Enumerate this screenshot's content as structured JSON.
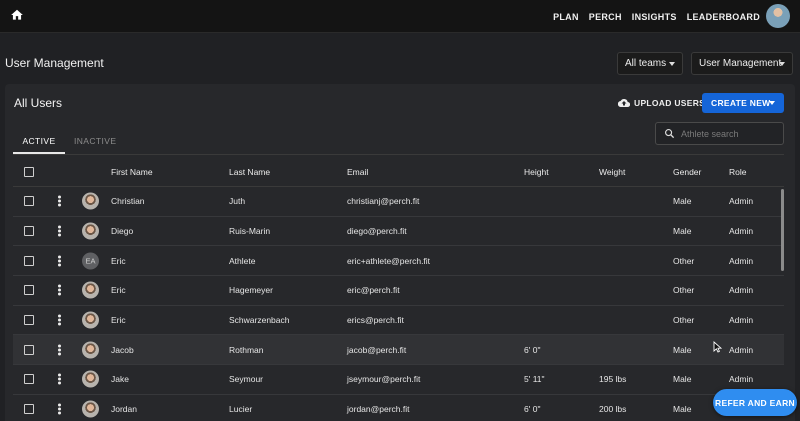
{
  "nav": {
    "home_icon": "home-icon",
    "items": [
      "PLAN",
      "PERCH",
      "INSIGHTS",
      "LEADERBOARD"
    ]
  },
  "header": {
    "title": "User Management",
    "teams_select": "All teams",
    "section_select": "User Management"
  },
  "panel": {
    "title": "All Users",
    "upload_label": "UPLOAD USERS",
    "create_label": "CREATE NEW",
    "tabs": [
      "ACTIVE",
      "INACTIVE"
    ],
    "active_tab": "ACTIVE",
    "search_placeholder": "Athlete search"
  },
  "table": {
    "columns": [
      "First Name",
      "Last Name",
      "Email",
      "Height",
      "Weight",
      "Gender",
      "Role"
    ],
    "rows": [
      {
        "avatar": "photo",
        "first": "Christian",
        "last": "Juth",
        "email": "christianj@perch.fit",
        "height": "",
        "weight": "",
        "gender": "Male",
        "role": "Admin"
      },
      {
        "avatar": "photo",
        "first": "Diego",
        "last": "Ruis-Marin",
        "email": "diego@perch.fit",
        "height": "",
        "weight": "",
        "gender": "Male",
        "role": "Admin"
      },
      {
        "avatar": "initials",
        "initials": "EA",
        "first": "Eric",
        "last": "Athlete",
        "email": "eric+athlete@perch.fit",
        "height": "",
        "weight": "",
        "gender": "Other",
        "role": "Admin"
      },
      {
        "avatar": "photo",
        "first": "Eric",
        "last": "Hagemeyer",
        "email": "eric@perch.fit",
        "height": "",
        "weight": "",
        "gender": "Other",
        "role": "Admin"
      },
      {
        "avatar": "photo",
        "first": "Eric",
        "last": "Schwarzenbach",
        "email": "erics@perch.fit",
        "height": "",
        "weight": "",
        "gender": "Other",
        "role": "Admin"
      },
      {
        "avatar": "photo",
        "first": "Jacob",
        "last": "Rothman",
        "email": "jacob@perch.fit",
        "height": "6' 0\"",
        "weight": "",
        "gender": "Male",
        "role": "Admin"
      },
      {
        "avatar": "photo",
        "first": "Jake",
        "last": "Seymour",
        "email": "jseymour@perch.fit",
        "height": "5' 11\"",
        "weight": "195 lbs",
        "gender": "Male",
        "role": "Admin"
      },
      {
        "avatar": "photo",
        "first": "Jordan",
        "last": "Lucier",
        "email": "jordan@perch.fit",
        "height": "6' 0\"",
        "weight": "200 lbs",
        "gender": "Male",
        "role": "Admin"
      }
    ]
  },
  "refer_label": "REFER AND EARN",
  "colors": {
    "primary": "#1565d8",
    "refer": "#2f8df0",
    "background": "#202124",
    "panel": "#27282b"
  }
}
